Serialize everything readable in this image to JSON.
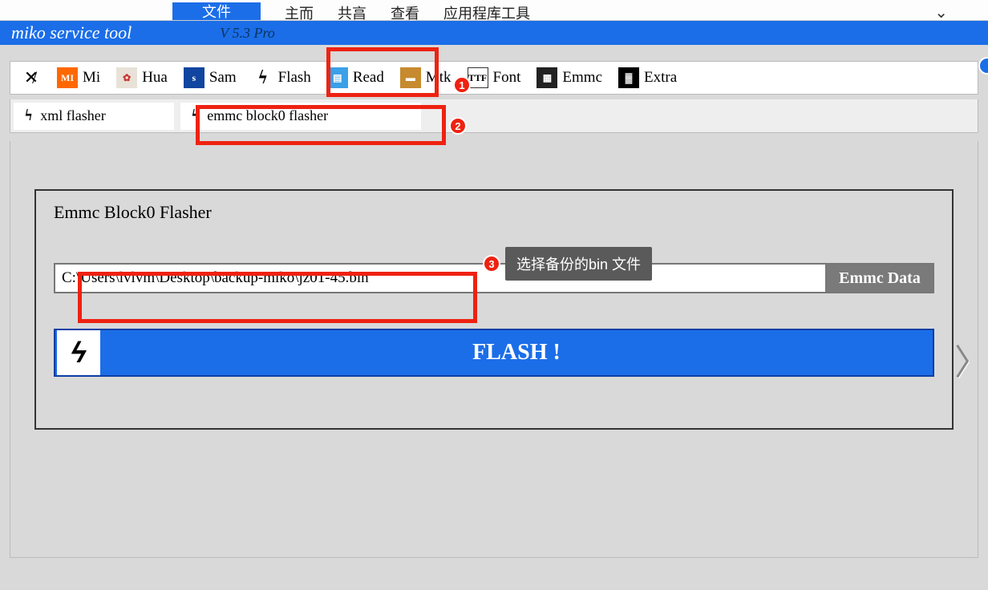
{
  "top_menu": {
    "file": "文件",
    "home": "主而",
    "share": "共亯",
    "view": "查看",
    "app_tools": "应用程库工具"
  },
  "title": "miko service tool",
  "version": "V 5.3 Pro",
  "toolbar": {
    "mi": "Mi",
    "hua": "Hua",
    "sam": "Sam",
    "flash": "Flash",
    "read": "Read",
    "mtk": "Mtk",
    "font": "Font",
    "emmc": "Emmc",
    "extra": "Extra"
  },
  "subtabs": {
    "xml": "xml flasher",
    "emmc": "emmc block0 flasher"
  },
  "group_title": "Emmc Block0 Flasher",
  "file_path": "C:\\Users\\lvlvm\\Desktop\\backup-miko\\jz01-45.bin",
  "emmc_data_btn": "Emmc Data",
  "flash_label": "FLASH !",
  "callouts": {
    "n1": "1",
    "n2": "2",
    "n3": "3",
    "tip": "选择备份的bin 文件"
  }
}
